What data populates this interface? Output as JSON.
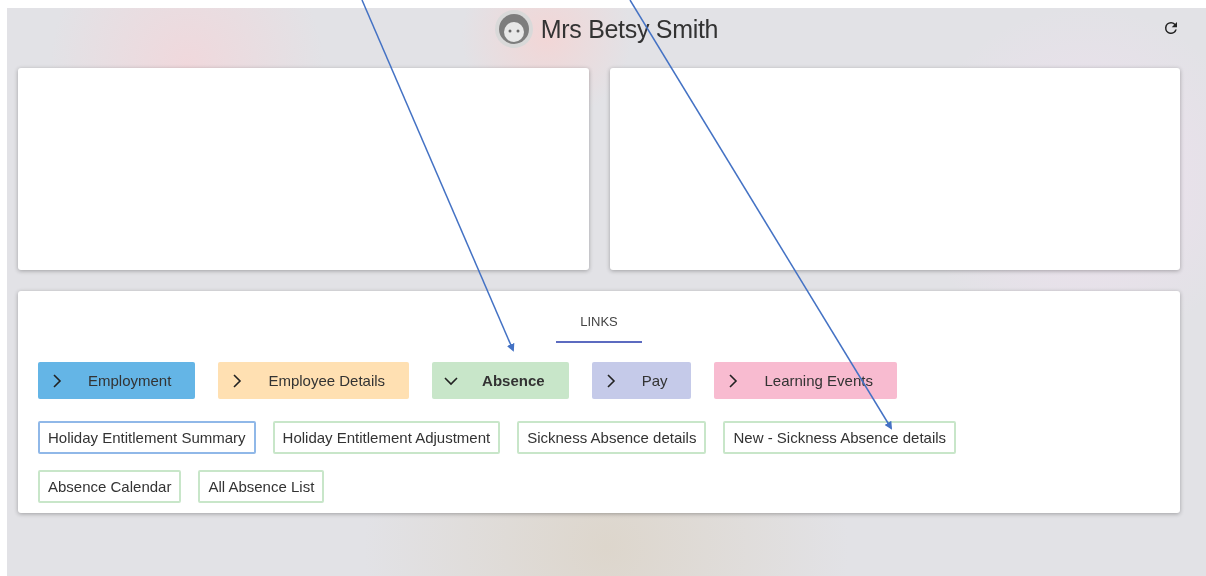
{
  "header": {
    "name": "Mrs Betsy Smith"
  },
  "links_panel": {
    "title": "LINKS",
    "categories": [
      {
        "label": "Employment",
        "color": "#64b5e6",
        "expanded": false
      },
      {
        "label": "Employee Details",
        "color": "#ffe0b2",
        "expanded": false
      },
      {
        "label": "Absence",
        "color": "#c8e6c9",
        "expanded": true
      },
      {
        "label": "Pay",
        "color": "#c5cae9",
        "expanded": false
      },
      {
        "label": "Learning Events",
        "color": "#f8bbd0",
        "expanded": false
      }
    ],
    "links": [
      {
        "label": "Holiday Entitlement Summary",
        "selected": true
      },
      {
        "label": "Holiday Entitlement Adjustment",
        "selected": false
      },
      {
        "label": "Sickness Absence details",
        "selected": false
      },
      {
        "label": "New - Sickness Absence details",
        "selected": false
      },
      {
        "label": "Absence Calendar",
        "selected": false
      },
      {
        "label": "All Absence List",
        "selected": false
      }
    ]
  }
}
